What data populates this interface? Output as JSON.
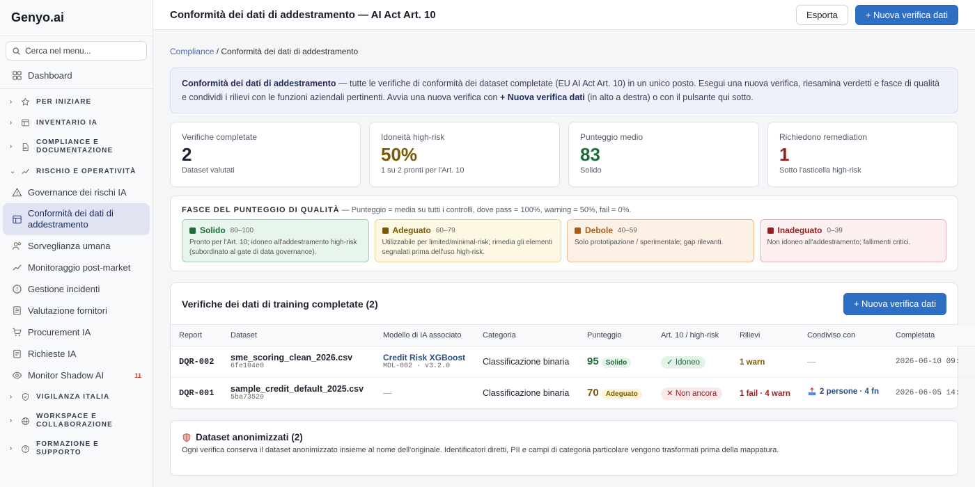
{
  "brand": "Genyo.ai",
  "search": {
    "placeholder": "Cerca nel menu..."
  },
  "sidebar": {
    "dashboard": "Dashboard",
    "sections": {
      "per_iniziare": "PER INIZIARE",
      "inventario": "INVENTARIO IA",
      "compliance_1": "COMPLIANCE E",
      "compliance_2": "DOCUMENTAZIONE",
      "rischio": "RISCHIO E OPERATIVITÀ",
      "vigilanza": "VIGILANZA ITALIA",
      "workspace_1": "WORKSPACE E",
      "workspace_2": "COLLABORAZIONE",
      "formazione_1": "FORMAZIONE E",
      "formazione_2": "SUPPORTO"
    },
    "items": {
      "governance": "Governance dei rischi IA",
      "conformita_1": "Conformità dei dati di",
      "conformita_2": "addestramento",
      "sorveglianza": "Sorveglianza umana",
      "monitoraggio": "Monitoraggio post-market",
      "incidenti": "Gestione incidenti",
      "fornitori": "Valutazione fornitori",
      "procurement": "Procurement IA",
      "richieste": "Richieste IA",
      "shadow": "Monitor Shadow AI",
      "shadow_badge": "11"
    }
  },
  "header": {
    "title": "Conformità dei dati di addestramento — AI Act Art. 10",
    "export": "Esporta",
    "new_check": "+ Nuova verifica dati"
  },
  "breadcrumb": {
    "root": "Compliance",
    "sep": " / ",
    "current": "Conformità dei dati di addestramento"
  },
  "intro": {
    "bold1": "Conformità dei dati di addestramento",
    "text1": " — tutte le verifiche di conformità dei dataset completate (EU AI Act Art. 10) in un unico posto. Esegui una nuova verifica, riesamina verdetti e fasce di qualità e condividi i rilievi con le funzioni aziendali pertinenti. Avvia una nuova verifica con ",
    "bold2": "+ Nuova verifica dati",
    "text2": " (in alto a destra) o con il pulsante qui sotto."
  },
  "stats": [
    {
      "label": "Verifiche completate",
      "value": "2",
      "sub": "Dataset valutati",
      "color": "#1a2238"
    },
    {
      "label": "Idoneità high-risk",
      "value": "50%",
      "sub": "1 su 2 pronti per l'Art. 10",
      "color": "#7a5a00"
    },
    {
      "label": "Punteggio medio",
      "value": "83",
      "sub": "Solido",
      "color": "#1f6b3a"
    },
    {
      "label": "Richiedono remediation",
      "value": "1",
      "sub": "Sotto l'asticella high-risk",
      "color": "#9b1c1c"
    }
  ],
  "bands": {
    "title": "FASCE DEL PUNTEGGIO DI QUALITÀ",
    "subtitle": " — Punteggio = media su tutti i controlli, dove pass = 100%, warning = 50%, fail = 0%.",
    "items": [
      {
        "name": "Solido",
        "range": "80–100",
        "desc": "Pronto per l'Art. 10; idoneo all'addestramento high-risk (subordinato al gate di data governance).",
        "color": "#1f6b3a",
        "bg": "#e8f5ec",
        "border": "#9fd1ad"
      },
      {
        "name": "Adeguato",
        "range": "60–79",
        "desc": "Utilizzabile per limited/minimal-risk; rimedia gli elementi segnalati prima dell'uso high-risk.",
        "color": "#7a5a00",
        "bg": "#fdf8e4",
        "border": "#e9d58f"
      },
      {
        "name": "Debole",
        "range": "40–59",
        "desc": "Solo prototipazione / sperimentale; gap rilevanti.",
        "color": "#b25a12",
        "bg": "#fdf1e6",
        "border": "#eebf94"
      },
      {
        "name": "Inadeguato",
        "range": "0–39",
        "desc": "Non idoneo all'addestramento; fallimenti critici.",
        "color": "#9b1c1c",
        "bg": "#fcefef",
        "border": "#eab3b3"
      }
    ]
  },
  "table": {
    "title": "Verifiche dei dati di training completate (2)",
    "new_button": "+ Nuova verifica dati",
    "columns": [
      "Report",
      "Dataset",
      "Modello di IA associato",
      "Categoria",
      "Punteggio",
      "Art. 10 / high-risk",
      "Rilievi",
      "Condiviso con",
      "Completata"
    ],
    "rows": [
      {
        "report": "DQR-002",
        "dataset": "sme_scoring_clean_2026.csv",
        "hash": "6fe104e0",
        "model": "Credit Risk XGBoost",
        "model_sub": "MDL-002 · v3.2.0",
        "category": "Classificazione binaria",
        "score": "95",
        "band": "Solido",
        "status": "✓ Idoneo",
        "findings": "1 warn",
        "shared": "—",
        "completed": "2026-06-10 09:"
      },
      {
        "report": "DQR-001",
        "dataset": "sample_credit_default_2025.csv",
        "hash": "5ba73520",
        "model": "—",
        "model_sub": "",
        "category": "Classificazione binaria",
        "score": "70",
        "band": "Adeguato",
        "status": "✕ Non ancora",
        "findings": "1 fail · 4 warn",
        "shared": "2 persone · 4 fn",
        "completed": "2026-06-05 14:"
      }
    ]
  },
  "anon": {
    "title": "Dataset anonimizzati (2)",
    "desc": "Ogni verifica conserva il dataset anonimizzato insieme al nome dell'originale. Identificatori diretti, PII e campi di categoria particolare vengono trasformati prima della mappatura."
  }
}
